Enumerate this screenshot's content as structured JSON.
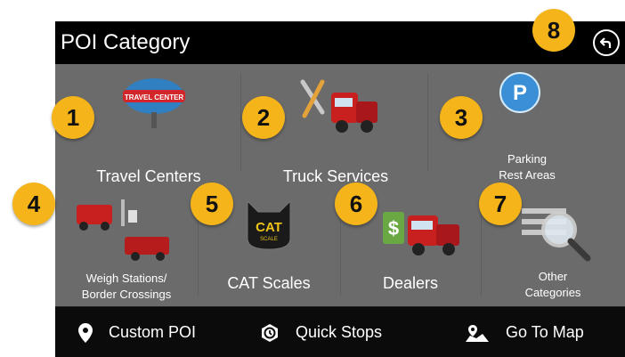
{
  "header": {
    "title": "POI Category"
  },
  "tiles": [
    {
      "label": "Travel Centers"
    },
    {
      "label": "Truck Services"
    },
    {
      "label_line1": "Parking",
      "label_line2": "Rest Areas"
    },
    {
      "label_line1": "Weigh Stations/",
      "label_line2": "Border Crossings"
    },
    {
      "label": "CAT Scales",
      "icon_text": "CAT",
      "icon_subtext": "SCALE"
    },
    {
      "label": "Dealers"
    },
    {
      "label_line1": "Other",
      "label_line2": "Categories"
    }
  ],
  "travel_sign": "TRAVEL CENTER",
  "parking_icon_letter": "P",
  "dealer_icon_symbol": "$",
  "bottom_bar": [
    {
      "label": "Custom POI",
      "icon": "map-pin-icon"
    },
    {
      "label": "Quick Stops",
      "icon": "quick-stops-icon"
    },
    {
      "label": "Go To Map",
      "icon": "map-icon"
    }
  ],
  "badges": [
    "1",
    "2",
    "3",
    "4",
    "5",
    "6",
    "7",
    "8"
  ],
  "colors": {
    "badge": "#f4b41a",
    "tile_bg": "#6b6b6b",
    "truck_red": "#c8201e",
    "parking_blue": "#3a8fd6"
  }
}
